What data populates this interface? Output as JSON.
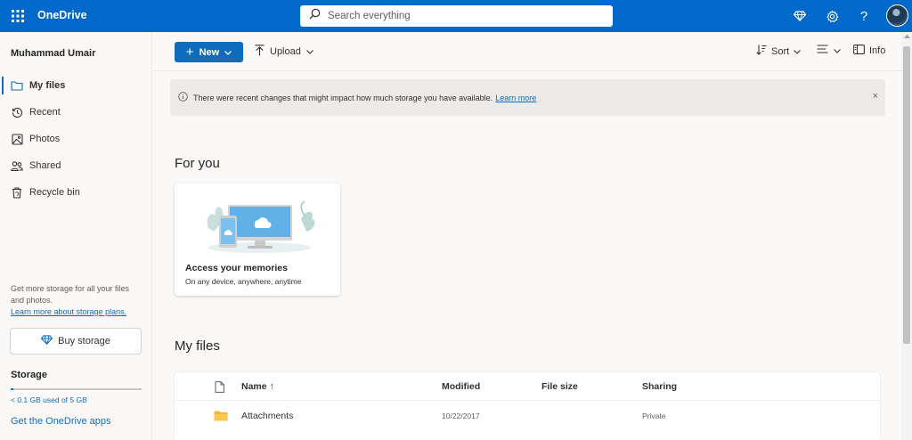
{
  "app": {
    "title": "OneDrive"
  },
  "search": {
    "placeholder": "Search everything"
  },
  "header_icons": [
    "premium-diamond-icon",
    "settings-gear-icon",
    "help-question-icon",
    "account-avatar"
  ],
  "sidebar": {
    "user_name": "Muhammad Umair",
    "items": [
      {
        "label": "My files",
        "icon": "folder-icon",
        "active": true
      },
      {
        "label": "Recent",
        "icon": "recent-clock-icon"
      },
      {
        "label": "Photos",
        "icon": "photo-icon"
      },
      {
        "label": "Shared",
        "icon": "people-icon"
      },
      {
        "label": "Recycle bin",
        "icon": "recycle-bin-icon"
      }
    ],
    "promo_text": "Get more storage for all your files and photos.",
    "promo_link": "Learn more about storage plans.",
    "buy_storage": "Buy storage",
    "storage_title": "Storage",
    "storage_used": "< 0.1 GB used of 5 GB",
    "storage_fraction": 0.02,
    "get_apps": "Get the OneDrive apps"
  },
  "toolbar": {
    "new_label": "New",
    "upload_label": "Upload",
    "sort_label": "Sort",
    "info_label": "Info"
  },
  "banner": {
    "text": "There were recent changes that might impact how much storage you have available.",
    "link": "Learn more",
    "close": "×"
  },
  "for_you": {
    "title": "For you",
    "card_title": "Access your memories",
    "card_subtitle": "On any device, anywhere, anytime"
  },
  "my_files": {
    "title": "My files",
    "columns": [
      "Name ↑",
      "Modified",
      "File size",
      "Sharing"
    ],
    "rows": [
      {
        "name": "Attachments",
        "modified": "10/22/2017",
        "size": "",
        "sharing": "Private",
        "icon": "folder-icon"
      }
    ]
  },
  "colors": {
    "brand": "#0069c9",
    "accent": "#0f6cbd",
    "folder": "#f4b63f"
  }
}
